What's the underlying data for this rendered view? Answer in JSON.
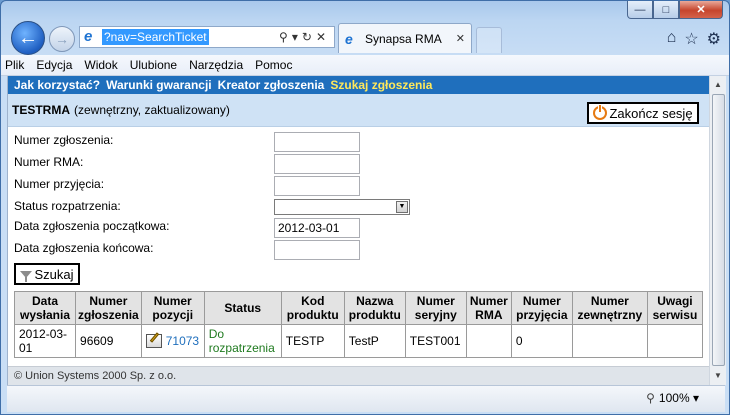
{
  "browser": {
    "address": "?nav=SearchTicket",
    "tab_label": "Synapsa RMA",
    "zoom": "100%",
    "menu": [
      "Plik",
      "Edycja",
      "Widok",
      "Ulubione",
      "Narzędzia",
      "Pomoc"
    ]
  },
  "nav": {
    "items": [
      "Jak korzystać?",
      "Warunki gwarancji",
      "Kreator zgłoszenia",
      "Szukaj zgłoszenia"
    ],
    "active_index": 3
  },
  "user": {
    "name": "TESTRMA",
    "description": "(zewnętrzny, zaktualizowany)",
    "logout_label": "Zakończ sesję"
  },
  "form": {
    "ticket_number_label": "Numer zgłoszenia:",
    "rma_number_label": "Numer RMA:",
    "receipt_number_label": "Numer przyjęcia:",
    "status_label": "Status rozpatrzenia:",
    "date_from_label": "Data zgłoszenia początkowa:",
    "date_from_value": "2012-03-01",
    "date_to_label": "Data zgłoszenia końcowa:",
    "search_label": "Szukaj"
  },
  "table": {
    "headers": [
      "Data wysłania",
      "Numer zgłoszenia",
      "Numer pozycji",
      "Status",
      "Kod produktu",
      "Nazwa produktu",
      "Numer seryjny",
      "Numer RMA",
      "Numer przyjęcia",
      "Numer zewnętrzny",
      "Uwagi serwisu"
    ],
    "rows": [
      {
        "sent_date": "2012-03-01",
        "ticket_number": "96609",
        "position_number": "71073",
        "status": "Do rozpatrzenia",
        "product_code": "TESTP",
        "product_name": "TestP",
        "serial_number": "TEST001",
        "rma_number": "",
        "receipt_number": "0",
        "external_number": "",
        "service_notes": ""
      }
    ]
  },
  "footer": {
    "copyright": "© Union Systems 2000 Sp. z o.o."
  }
}
